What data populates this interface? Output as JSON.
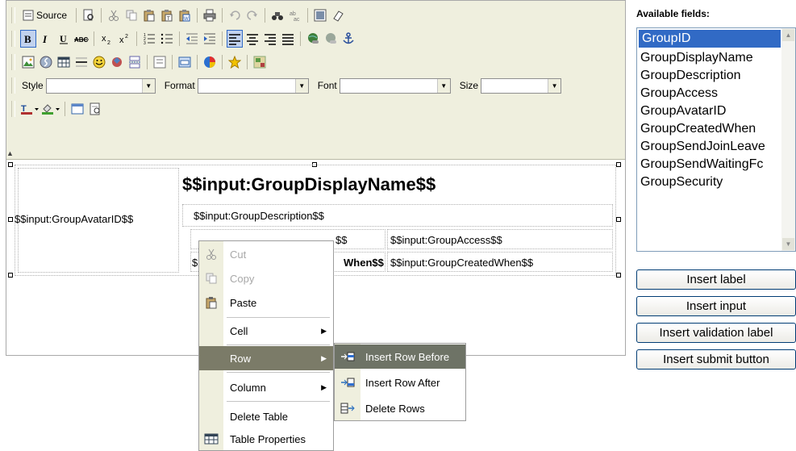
{
  "toolbar": {
    "source_label": "Source",
    "style_label": "Style",
    "format_label": "Format",
    "font_label": "Font",
    "size_label": "Size"
  },
  "content": {
    "display_name": "$$input:GroupDisplayName$$",
    "avatar": "$$input:GroupAvatarID$$",
    "description": "$$input:GroupDescription$$",
    "access_label_visible": "$$",
    "access_input": "$$input:GroupAccess$$",
    "created_label_left": "$",
    "created_label_right": "When$$",
    "created_input": "$$input:GroupCreatedWhen$$"
  },
  "fields_panel": {
    "title": "Available fields:",
    "fields": [
      "GroupID",
      "GroupDisplayName",
      "GroupDescription",
      "GroupAccess",
      "GroupAvatarID",
      "GroupCreatedWhen",
      "GroupSendJoinLeave",
      "GroupSendWaitingFc",
      "GroupSecurity"
    ],
    "selected_index": 0
  },
  "buttons": {
    "insert_label": "Insert label",
    "insert_input": "Insert input",
    "insert_validation_label": "Insert validation label",
    "insert_submit_button": "Insert submit button"
  },
  "context_menu": {
    "items": [
      "Cut",
      "Copy",
      "Paste",
      "Cell",
      "Row",
      "Column",
      "Delete Table",
      "Table Properties"
    ],
    "disabled": [
      "Cut",
      "Copy"
    ],
    "highlighted": "Row"
  },
  "row_submenu": {
    "items": [
      "Insert Row Before",
      "Insert Row After",
      "Delete Rows"
    ],
    "highlighted": "Insert Row Before"
  },
  "colors": {
    "toolbar_bg": "#efefde",
    "selection": "#316ac5",
    "menu_highlight": "#7b7b68"
  }
}
